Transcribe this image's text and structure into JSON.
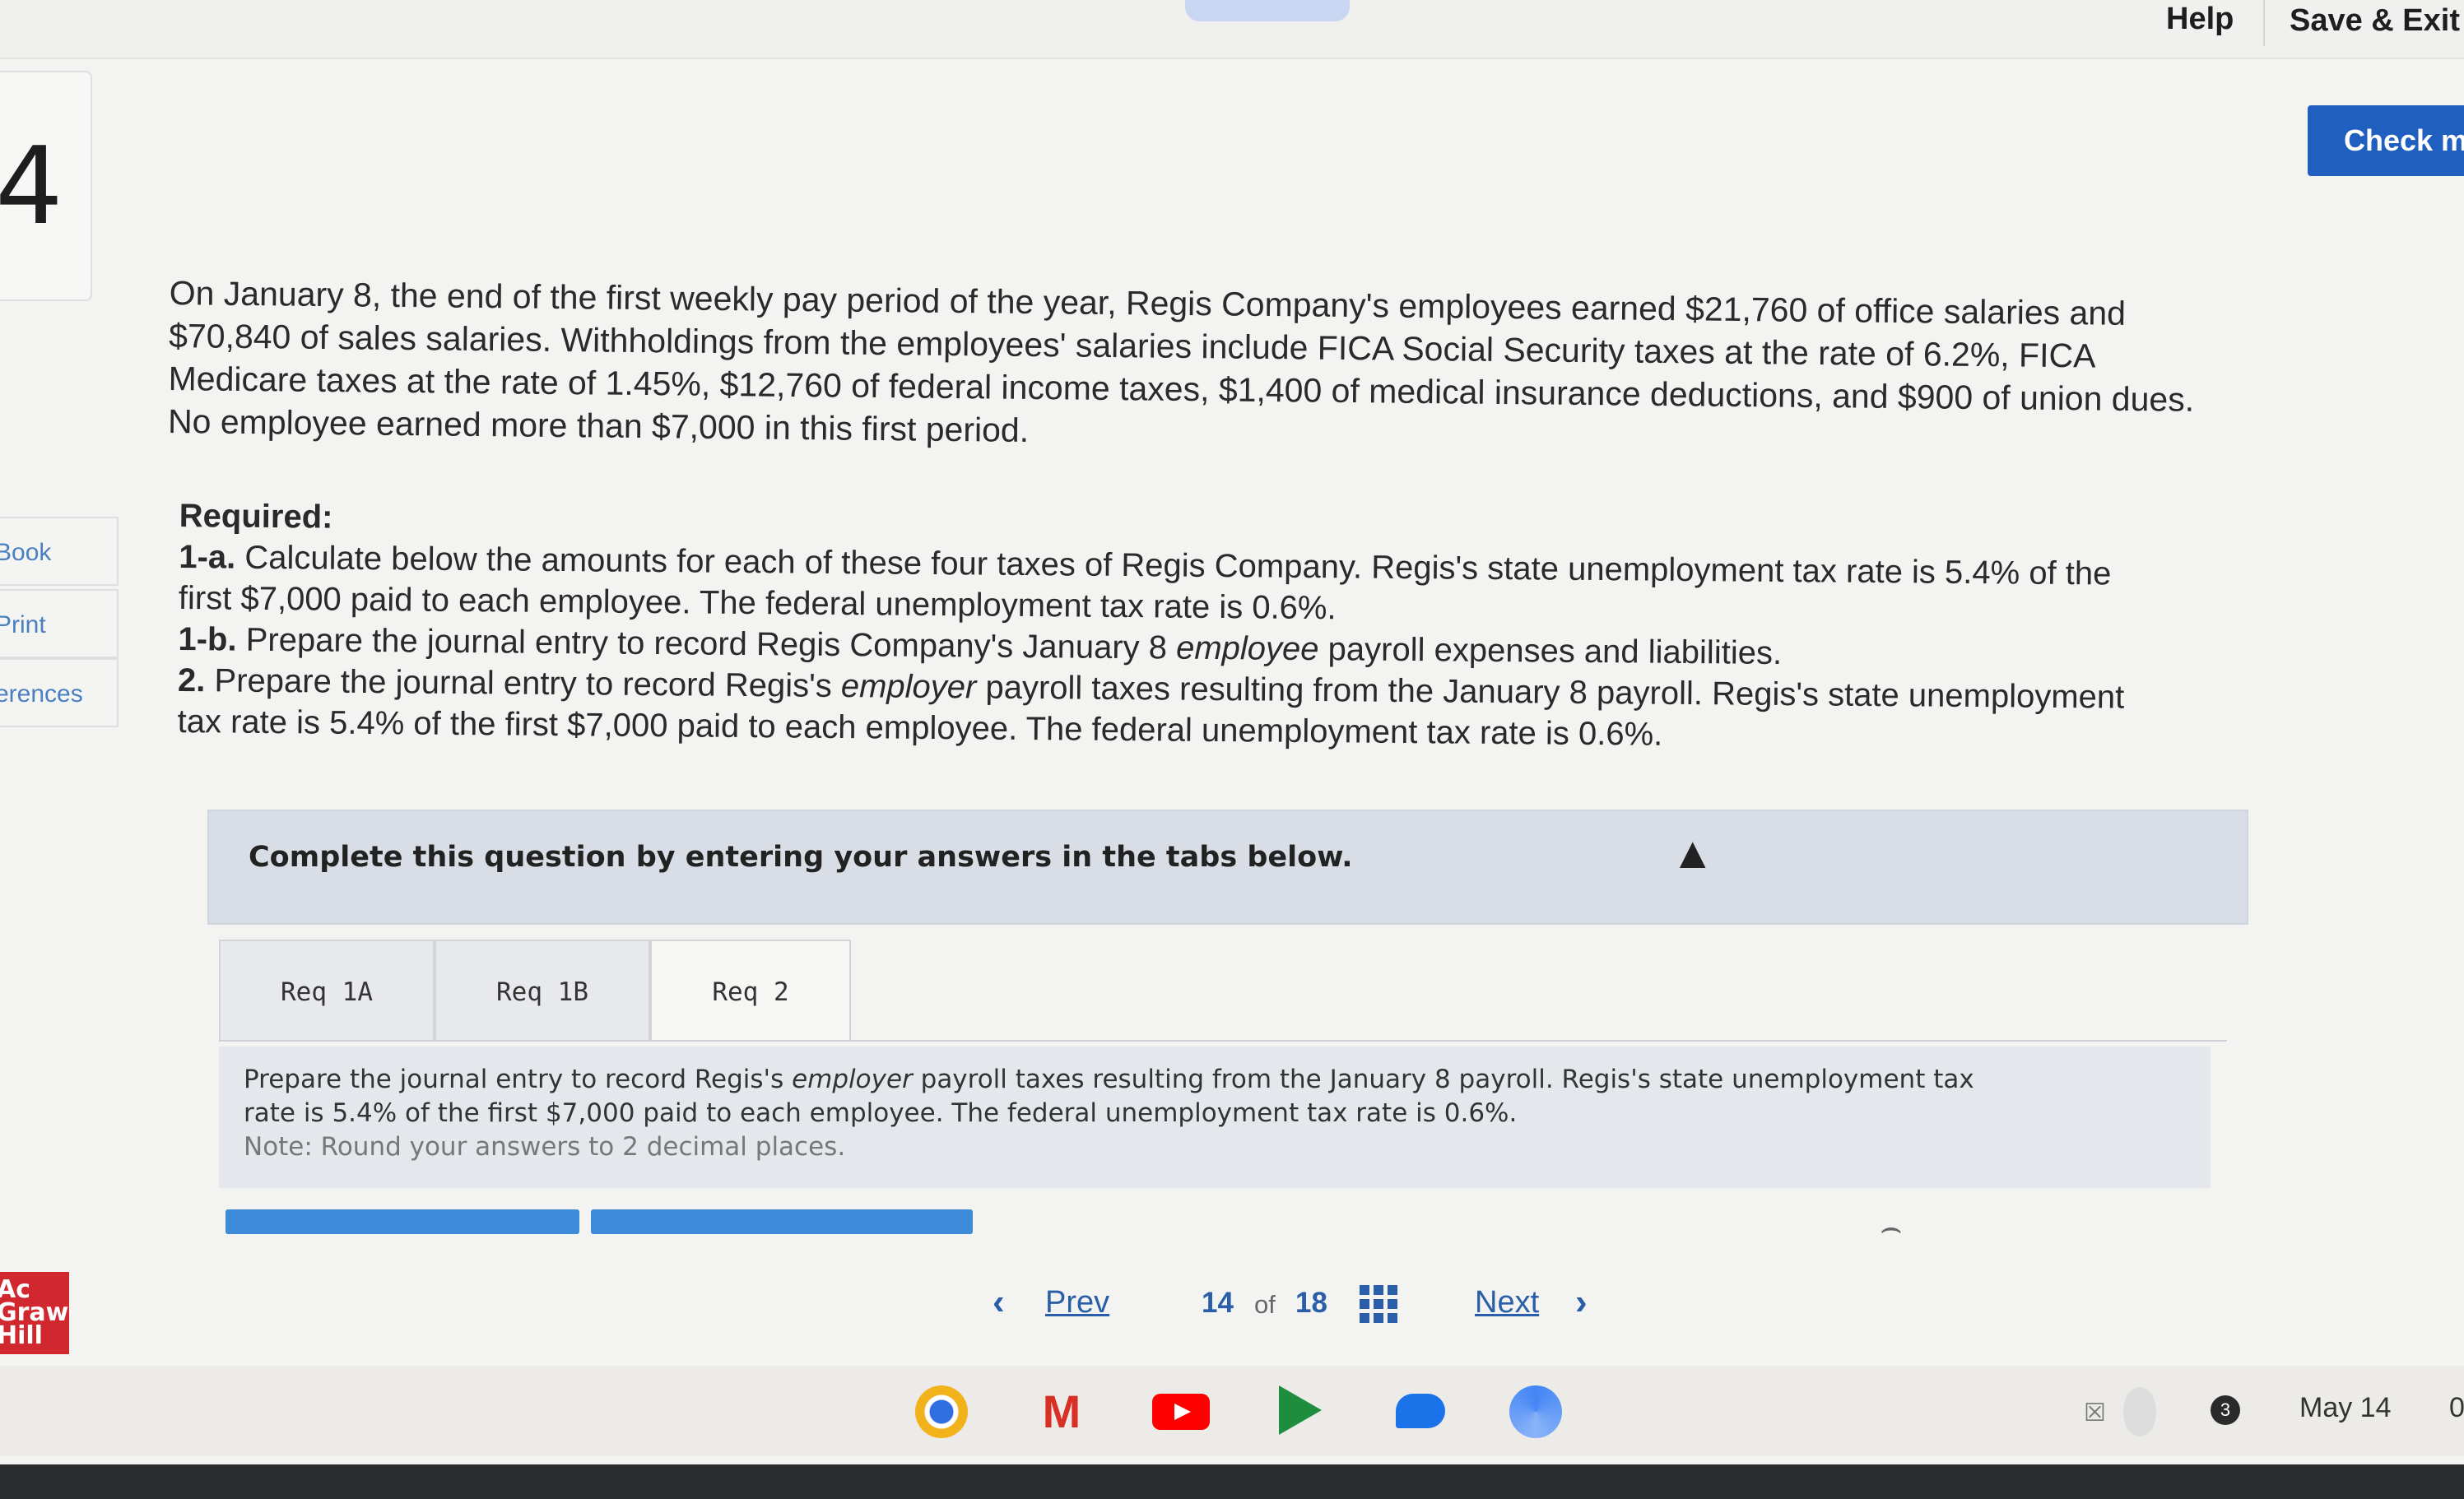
{
  "header": {
    "help_label": "Help",
    "save_exit_label": "Save & Exit",
    "check_label": "Check m"
  },
  "sidebar": {
    "question_number": "4",
    "links": [
      "Book",
      "Print",
      "erences"
    ],
    "logo_lines": [
      "Ac",
      "Graw",
      "Hill"
    ]
  },
  "question": {
    "intro_lines": [
      "On January 8, the end of the first weekly pay period of the year, Regis Company's employees earned $21,760 of office salaries and",
      "$70,840 of sales salaries. Withholdings from the employees' salaries include FICA Social Security taxes at the rate of 6.2%, FICA",
      "Medicare taxes at the rate of 1.45%, $12,760 of federal income taxes, $1,400 of medical insurance deductions, and $900 of union dues.",
      "No employee earned more than $7,000 in this first period."
    ],
    "required_title": "Required:",
    "req_1a_label": "1-a.",
    "req_1a_line1": " Calculate below the amounts for each of these four taxes of Regis Company. Regis's state unemployment tax rate is 5.4% of the",
    "req_1a_line2": "first $7,000 paid to each employee. The federal unemployment tax rate is 0.6%.",
    "req_1b_label": "1-b.",
    "req_1b_pre": " Prepare the journal entry to record Regis Company's January 8 ",
    "req_1b_em": "employee",
    "req_1b_post": " payroll expenses and liabilities.",
    "req_2_label": "2.",
    "req_2_pre": " Prepare the journal entry to record Regis's ",
    "req_2_em": "employer",
    "req_2_post": " payroll taxes resulting from the January 8 payroll. Regis's state unemployment",
    "req_2_line2": "tax rate is 5.4% of the first $7,000 paid to each employee. The federal unemployment tax rate is 0.6%."
  },
  "panel": {
    "instruction": "Complete this question by entering your answers in the tabs below.",
    "tabs": [
      {
        "label": "Req 1A",
        "active": false
      },
      {
        "label": "Req 1B",
        "active": false
      },
      {
        "label": "Req 2",
        "active": true
      }
    ],
    "content_pre": "Prepare the journal entry to record Regis's ",
    "content_em": "employer",
    "content_post": " payroll taxes resulting from the January 8 payroll. Regis's state unemployment tax",
    "content_line2": "rate is 5.4% of the first $7,000 paid to each employee. The federal unemployment tax rate is 0.6%.",
    "note": "Note: Round your answers to 2 decimal places."
  },
  "pagination": {
    "prev_label": "Prev",
    "current": "14",
    "of_label": "of",
    "total": "18",
    "next_label": "Next"
  },
  "shelf": {
    "apps": [
      "chrome-icon",
      "gmail-icon",
      "youtube-icon",
      "play-store-icon",
      "messages-icon",
      "camera-icon"
    ],
    "badge_count": "3",
    "date": "May 14",
    "time_partial": "0"
  },
  "colors": {
    "accent_blue": "#1f5fbf",
    "progress_blue": "#3d8bd8",
    "logo_red": "#d0282e"
  }
}
